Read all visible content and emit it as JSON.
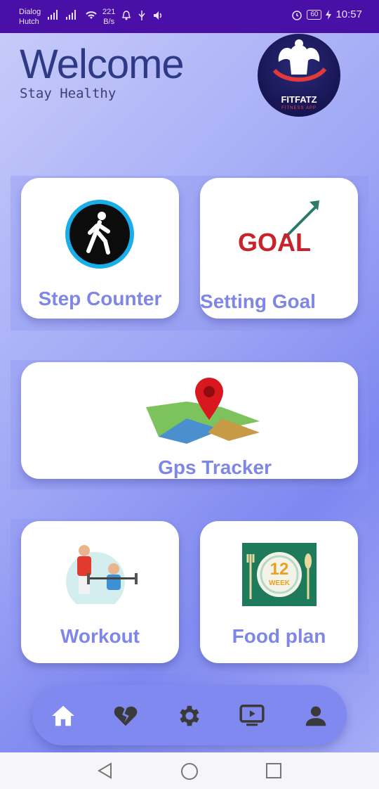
{
  "status_bar": {
    "carrier_line1": "Dialog",
    "carrier_line2": "Hutch",
    "speed_value": "221",
    "speed_unit": "B/s",
    "battery": "60",
    "time": "10:57"
  },
  "header": {
    "title": "Welcome",
    "subtitle": "Stay Healthy",
    "logo_name": "FITFATZ",
    "logo_tagline": "FITNESS APP"
  },
  "cards": {
    "step_counter": "Step Counter",
    "setting_goal": "Setting Goal",
    "goal_image_text": "GOAL",
    "gps_tracker": "Gps Tracker",
    "workout": "Workout",
    "food_plan": "Food plan",
    "food_badge_number": "12",
    "food_badge_text": "WEEK"
  },
  "bottom_nav": {
    "items": [
      "home-icon",
      "heart-broken-icon",
      "gear-icon",
      "video-icon",
      "person-icon"
    ],
    "active_color": "#ffffff",
    "icon_color": "#3a3a3a"
  },
  "colors": {
    "accent": "#7e86e6",
    "status_bar": "#4a0fa6",
    "nav_bar": "#8089ef"
  }
}
